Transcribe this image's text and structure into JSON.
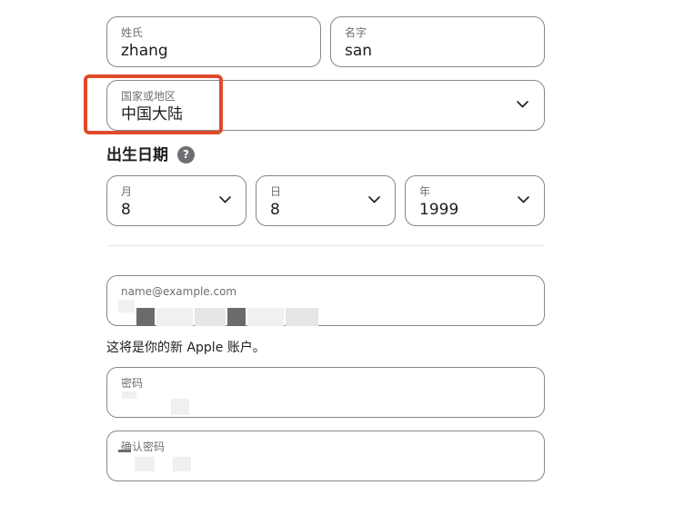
{
  "name": {
    "last_name_label": "姓氏",
    "last_name_value": "zhang",
    "first_name_label": "名字",
    "first_name_value": "san"
  },
  "region": {
    "label": "国家或地区",
    "value": "中国大陆"
  },
  "birthday": {
    "title": "出生日期",
    "help_symbol": "?",
    "month_label": "月",
    "month_value": "8",
    "day_label": "日",
    "day_value": "8",
    "year_label": "年",
    "year_value": "1999"
  },
  "account": {
    "email_placeholder": "name@example.com",
    "note": "这将是你的新 Apple 账户。",
    "password_label": "密码",
    "confirm_password_label": "确认密码"
  },
  "colors": {
    "highlight": "#e04a2a",
    "border": "#86868b",
    "label": "#6e6e73"
  },
  "icons": [
    "chevron-down-icon",
    "help-icon"
  ]
}
